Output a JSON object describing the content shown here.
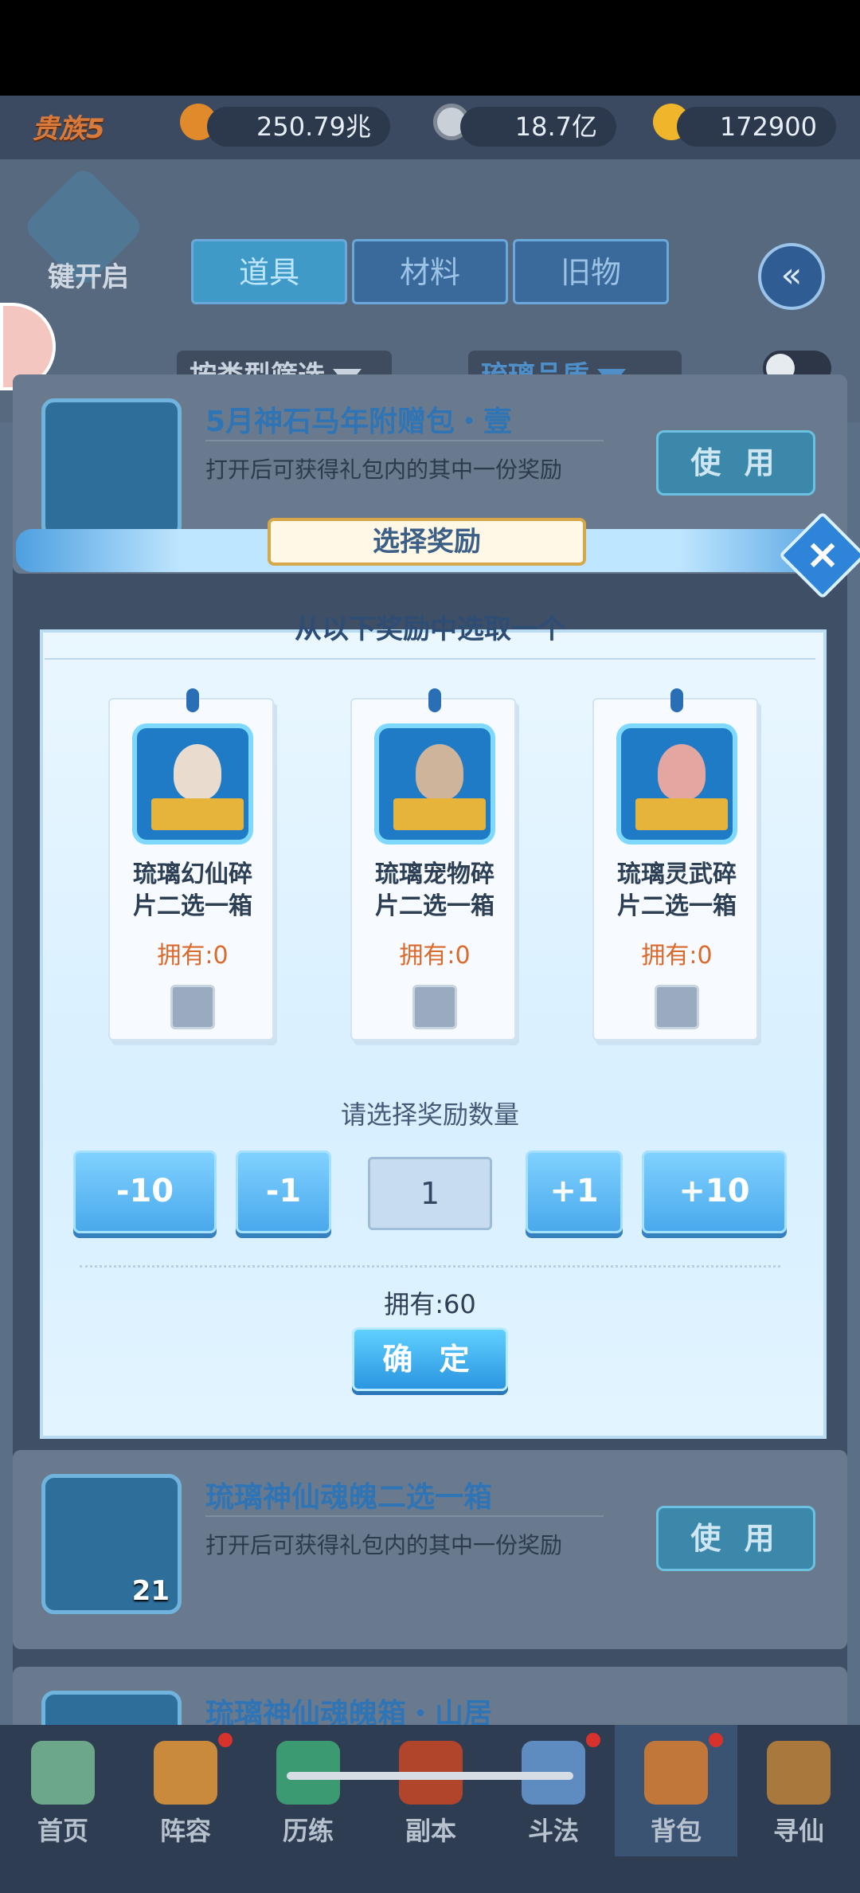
{
  "currency": {
    "vip": "贵族5",
    "power": "250.79兆",
    "coins": "18.7亿",
    "gold": "172900"
  },
  "header": {
    "one_key_open": "键开启",
    "tabs": [
      {
        "label": "道具",
        "active": true
      },
      {
        "label": "材料",
        "active": false
      },
      {
        "label": "旧物",
        "active": false
      }
    ],
    "filter_type": "按类型筛选",
    "filter_quality": "琉璃品质",
    "collapse_label": "收纳"
  },
  "items": [
    {
      "title": "5月神石马年附赠包・壹",
      "desc": "打开后可获得礼包内的其中一份奖励",
      "use": "使 用",
      "count": ""
    },
    {
      "title": "琉璃神仙魂魄二选一箱",
      "desc": "打开后可获得礼包内的其中一份奖励",
      "use": "使 用",
      "count": "21"
    },
    {
      "title": "琉璃神仙魂魄箱・山居",
      "desc": "",
      "use": "",
      "count": ""
    }
  ],
  "modal": {
    "title": "选择奖励",
    "subtitle": "从以下奖励中选取一个",
    "rewards": [
      {
        "name": "琉璃幻仙碎片二选一箱",
        "own": "拥有:0"
      },
      {
        "name": "琉璃宠物碎片二选一箱",
        "own": "拥有:0"
      },
      {
        "name": "琉璃灵武碎片二选一箱",
        "own": "拥有:0"
      }
    ],
    "qty_label": "请选择奖励数量",
    "qty_buttons": {
      "minus10": "-10",
      "minus1": "-1",
      "plus1": "+1",
      "plus10": "+10"
    },
    "qty_value": "1",
    "own_total": "拥有:60",
    "confirm": "确 定"
  },
  "nav": {
    "items": [
      {
        "label": "首页",
        "active": false
      },
      {
        "label": "阵容",
        "active": false
      },
      {
        "label": "历练",
        "active": false
      },
      {
        "label": "副本",
        "active": false
      },
      {
        "label": "斗法",
        "active": false
      },
      {
        "label": "背包",
        "active": true
      },
      {
        "label": "寻仙",
        "active": false
      }
    ]
  },
  "colors": {
    "accent": "#3f9ac8",
    "reward_own": "#d96a2c",
    "confirm": "#2b95e0"
  }
}
